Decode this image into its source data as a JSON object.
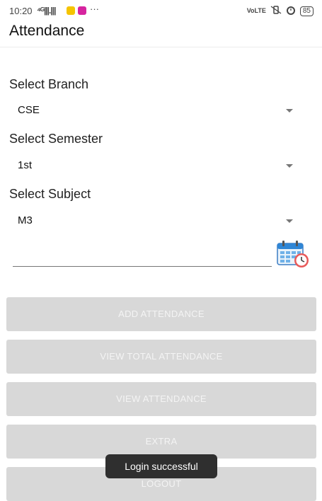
{
  "status_bar": {
    "time": "10:20",
    "signal": "⁴ᴳ|||.|||",
    "more": "···",
    "volte": "VoLTE",
    "battery": "85",
    "icons": [
      "notification-app-icon",
      "instagram-icon",
      "vibrate-off-icon",
      "alarm-icon",
      "battery-icon"
    ]
  },
  "app_bar": {
    "title": "Attendance"
  },
  "form": {
    "branch_label": "Select Branch",
    "branch_value": "CSE",
    "semester_label": "Select Semester",
    "semester_value": "1st",
    "subject_label": "Select Subject",
    "subject_value": "M3",
    "date_value": "",
    "calendar_icon": "calendar-clock-icon"
  },
  "buttons": {
    "add_attendance": "ADD ATTENDANCE",
    "view_total_attendance": "VIEW TOTAL ATTENDANCE",
    "view_attendance": "VIEW ATTENDANCE",
    "extra": "EXTRA",
    "logout": "LOGOUT"
  },
  "toast": {
    "message": "Login successful"
  },
  "colors": {
    "button_bg": "#d8d8d8",
    "button_text": "#f4f4f4",
    "toast_bg": "#2f2f2f"
  }
}
